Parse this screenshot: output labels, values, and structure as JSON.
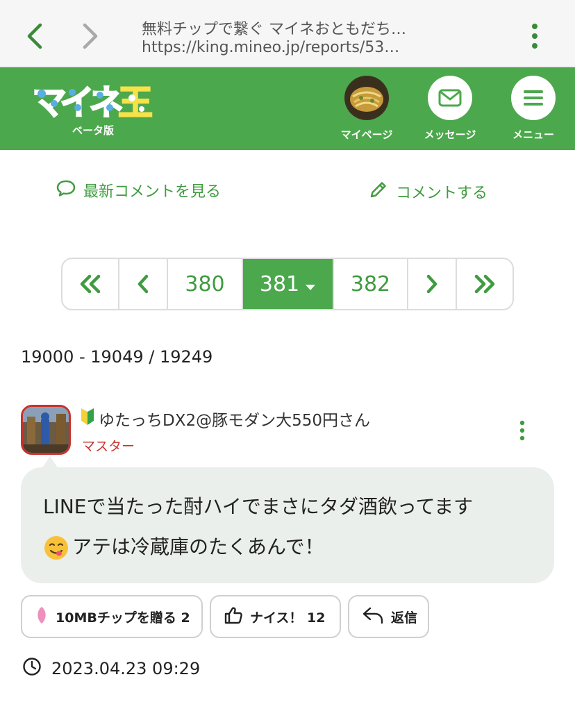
{
  "browser": {
    "tab_title": "無料チップで繋ぐ マイネおともだち…",
    "url": "https://king.mineo.jp/reports/53…"
  },
  "header": {
    "logo_sub": "ベータ版",
    "mypage_label": "マイページ",
    "message_label": "メッセージ",
    "menu_label": "メニュー"
  },
  "links": {
    "latest_comments": "最新コメントを見る",
    "post_comment": "コメントする"
  },
  "pagination": {
    "prev_page": "380",
    "current_page": "381",
    "next_page": "382"
  },
  "count_text": "19000 - 19049 / 19249",
  "post": {
    "user_name": "ゆたっちDX2@豚モダン大550円さん",
    "role": "マスター",
    "line1": "LINEで当たった酎ハイでまさにタダ酒飲ってます",
    "line2": "アテは冷蔵庫のたくあんで！",
    "chip_label": "10MBチップを贈る 2",
    "nice_label": "ナイス！ 12",
    "reply_label": "返信",
    "timestamp": "2023.04.23 09:29"
  },
  "colors": {
    "brand_green": "#4ca84c",
    "link_green": "#3f9c3f",
    "role_red": "#c8322e",
    "bubble_bg": "#ebefeb"
  }
}
